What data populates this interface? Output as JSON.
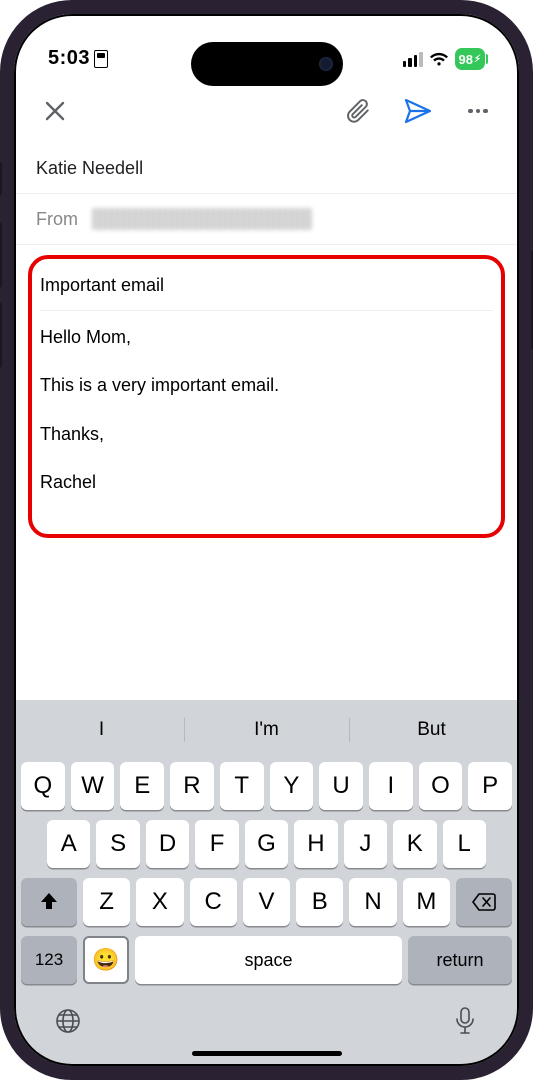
{
  "status": {
    "time": "5:03",
    "battery": "98"
  },
  "header": {
    "icons": {
      "close": "close-icon",
      "attach": "paperclip-icon",
      "send": "send-icon",
      "more": "more-icon"
    }
  },
  "compose": {
    "to": "Katie Needell",
    "from_label": "From",
    "subject": "Important email",
    "body_lines": [
      "Hello Mom,",
      "This is a very important email.",
      "Thanks,",
      "Rachel"
    ]
  },
  "keyboard": {
    "suggestions": [
      "I",
      "I'm",
      "But"
    ],
    "row1": [
      "Q",
      "W",
      "E",
      "R",
      "T",
      "Y",
      "U",
      "I",
      "O",
      "P"
    ],
    "row2": [
      "A",
      "S",
      "D",
      "F",
      "G",
      "H",
      "J",
      "K",
      "L"
    ],
    "row3": [
      "Z",
      "X",
      "C",
      "V",
      "B",
      "N",
      "M"
    ],
    "numkey": "123",
    "space": "space",
    "return": "return"
  }
}
